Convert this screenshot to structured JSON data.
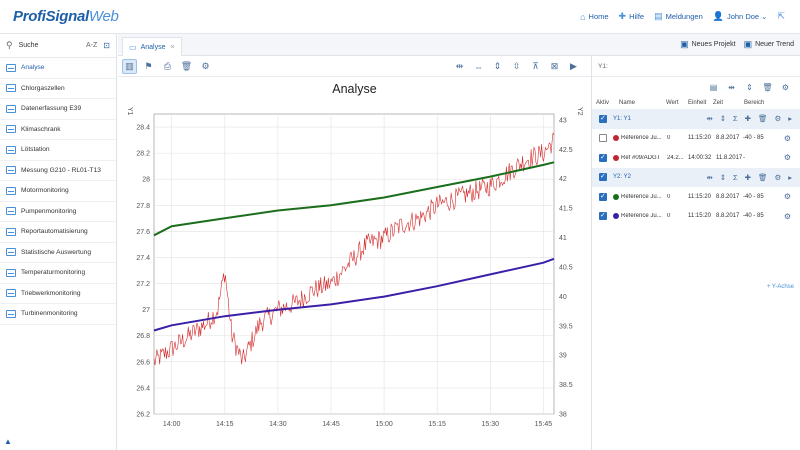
{
  "header": {
    "logo_part1": "ProfiSignal",
    "logo_part2": "Web",
    "nav": [
      {
        "icon": "⌂",
        "name": "home",
        "label": "Home"
      },
      {
        "icon": "✚",
        "name": "help",
        "label": "Hilfe"
      },
      {
        "icon": "▤",
        "name": "messages",
        "label": "Meldungen"
      },
      {
        "icon": "👤",
        "name": "user",
        "label": "John Doe ⌄"
      },
      {
        "icon": "⇱",
        "name": "external",
        "label": ""
      }
    ]
  },
  "sidebar": {
    "search_label": "Suche",
    "sort_label": "A-Z",
    "items": [
      {
        "label": "Analyse",
        "active": true
      },
      {
        "label": "Chlorgaszellen"
      },
      {
        "label": "Datenerfassung E39"
      },
      {
        "label": "Klimaschrank"
      },
      {
        "label": "Lötstation"
      },
      {
        "label": "Messung G210 - RL01-T13"
      },
      {
        "label": "Motormonitoring"
      },
      {
        "label": "Pumpenmonitoring"
      },
      {
        "label": "Reportautomatisierung"
      },
      {
        "label": "Statistische Auswertung"
      },
      {
        "label": "Temperaturmonitoring"
      },
      {
        "label": "Triebwerkmonitoring"
      },
      {
        "label": "Turbinenmonitoring"
      }
    ]
  },
  "tabs": {
    "active_label": "Analyse",
    "new_project": "Neues Projekt",
    "new_trend": "Neuer Trend"
  },
  "panel": {
    "header": "Y1:",
    "columns": {
      "active": "Aktiv",
      "name": "Name",
      "value": "Wert",
      "unit": "Einheit",
      "time": "Zeit",
      "range": "Bereich"
    },
    "groups": [
      {
        "label": "Y1: Y1",
        "rows": [
          {
            "checked": false,
            "color": "#c0272d",
            "name": "Reference Ju...",
            "value": "0",
            "time": "11:15:20",
            "date": "8.8.2017",
            "range": "-40 - 85"
          },
          {
            "checked": true,
            "color": "#c0272d",
            "name": "Ref #09/ADGT",
            "value": "24.2...",
            "time": "14:00:32",
            "date": "11.8.2017",
            "range": "-"
          }
        ]
      },
      {
        "label": "Y2: Y2",
        "rows": [
          {
            "checked": true,
            "color": "#1b6e1b",
            "name": "Reference Ju...",
            "value": "0",
            "time": "11:15:20",
            "date": "8.8.2017",
            "range": "-40 - 85"
          },
          {
            "checked": true,
            "color": "#3b1fa8",
            "name": "Reference Ju...",
            "value": "0",
            "time": "11:15:20",
            "date": "8.8.2017",
            "range": "-40 - 85"
          }
        ]
      }
    ],
    "add_axis": "+ Y-Achse"
  },
  "chart_data": {
    "type": "line",
    "title": "Analyse",
    "ylabel": "Y1",
    "y2label": "Y2",
    "xlim_minutes_of_day": [
      835,
      948
    ],
    "x_ticks": [
      "14:00",
      "14:15",
      "14:30",
      "14:45",
      "15:00",
      "15:15",
      "15:30",
      "15:45"
    ],
    "ylim": [
      26.2,
      28.5
    ],
    "y_ticks": [
      26.2,
      26.4,
      26.6,
      26.8,
      27.0,
      27.2,
      27.4,
      27.6,
      27.8,
      28.0,
      28.2,
      28.4
    ],
    "y2lim": [
      38.0,
      43.1
    ],
    "y2_ticks": [
      38.0,
      38.5,
      39.0,
      39.5,
      40.0,
      40.5,
      41.0,
      41.5,
      42.0,
      42.5,
      43.0
    ],
    "series": [
      {
        "axis": "y1",
        "color": "#d42a2a",
        "noisy": true,
        "x": [
          "13:55",
          "14:00",
          "14:05",
          "14:10",
          "14:13",
          "14:15",
          "14:17",
          "14:20",
          "14:25",
          "14:30",
          "14:35",
          "14:40",
          "14:45",
          "14:50",
          "14:55",
          "15:00",
          "15:05",
          "15:10",
          "15:15",
          "15:20",
          "15:25",
          "15:30",
          "15:35",
          "15:40",
          "15:45",
          "15:48"
        ],
        "y": [
          26.6,
          26.7,
          26.8,
          26.9,
          27.0,
          27.3,
          26.8,
          26.6,
          26.9,
          27.0,
          27.05,
          27.15,
          27.2,
          27.35,
          27.5,
          27.55,
          27.65,
          27.7,
          27.8,
          27.85,
          27.9,
          27.95,
          28.05,
          28.15,
          28.2,
          28.3
        ]
      },
      {
        "axis": "y1",
        "color": "#1b6e1b",
        "x": [
          "13:55",
          "14:00",
          "14:15",
          "14:30",
          "14:45",
          "15:00",
          "15:15",
          "15:30",
          "15:45",
          "15:48"
        ],
        "y": [
          27.57,
          27.64,
          27.7,
          27.76,
          27.8,
          27.86,
          27.94,
          28.02,
          28.11,
          28.13
        ]
      },
      {
        "axis": "y1",
        "color": "#3b1fa8",
        "x": [
          "13:55",
          "14:00",
          "14:15",
          "14:30",
          "14:45",
          "15:00",
          "15:15",
          "15:30",
          "15:45",
          "15:48"
        ],
        "y": [
          26.84,
          26.88,
          26.95,
          27.0,
          27.04,
          27.1,
          27.18,
          27.27,
          27.36,
          27.39
        ]
      }
    ]
  }
}
